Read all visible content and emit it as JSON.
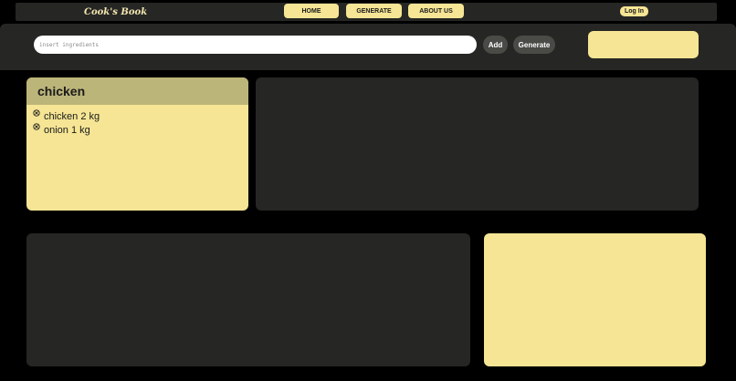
{
  "header": {
    "logo": "Cook's Book",
    "nav": [
      {
        "label": "HOME"
      },
      {
        "label": "GENERATE"
      },
      {
        "label": "ABOUT US"
      }
    ],
    "login_label": "Log In"
  },
  "search": {
    "placeholder": "insert ingredients",
    "value": "",
    "add_label": "Add",
    "generate_label": "Generate"
  },
  "recipe": {
    "title": "chicken",
    "ingredients": [
      {
        "text": "chicken 2 kg",
        "icon": "remove-icon"
      },
      {
        "text": "onion 1 kg",
        "icon": "remove-icon"
      }
    ]
  },
  "colors": {
    "accent": "#f5e594",
    "header_accent": "#bcb579",
    "panel_dark": "#262624",
    "background": "#000000"
  }
}
